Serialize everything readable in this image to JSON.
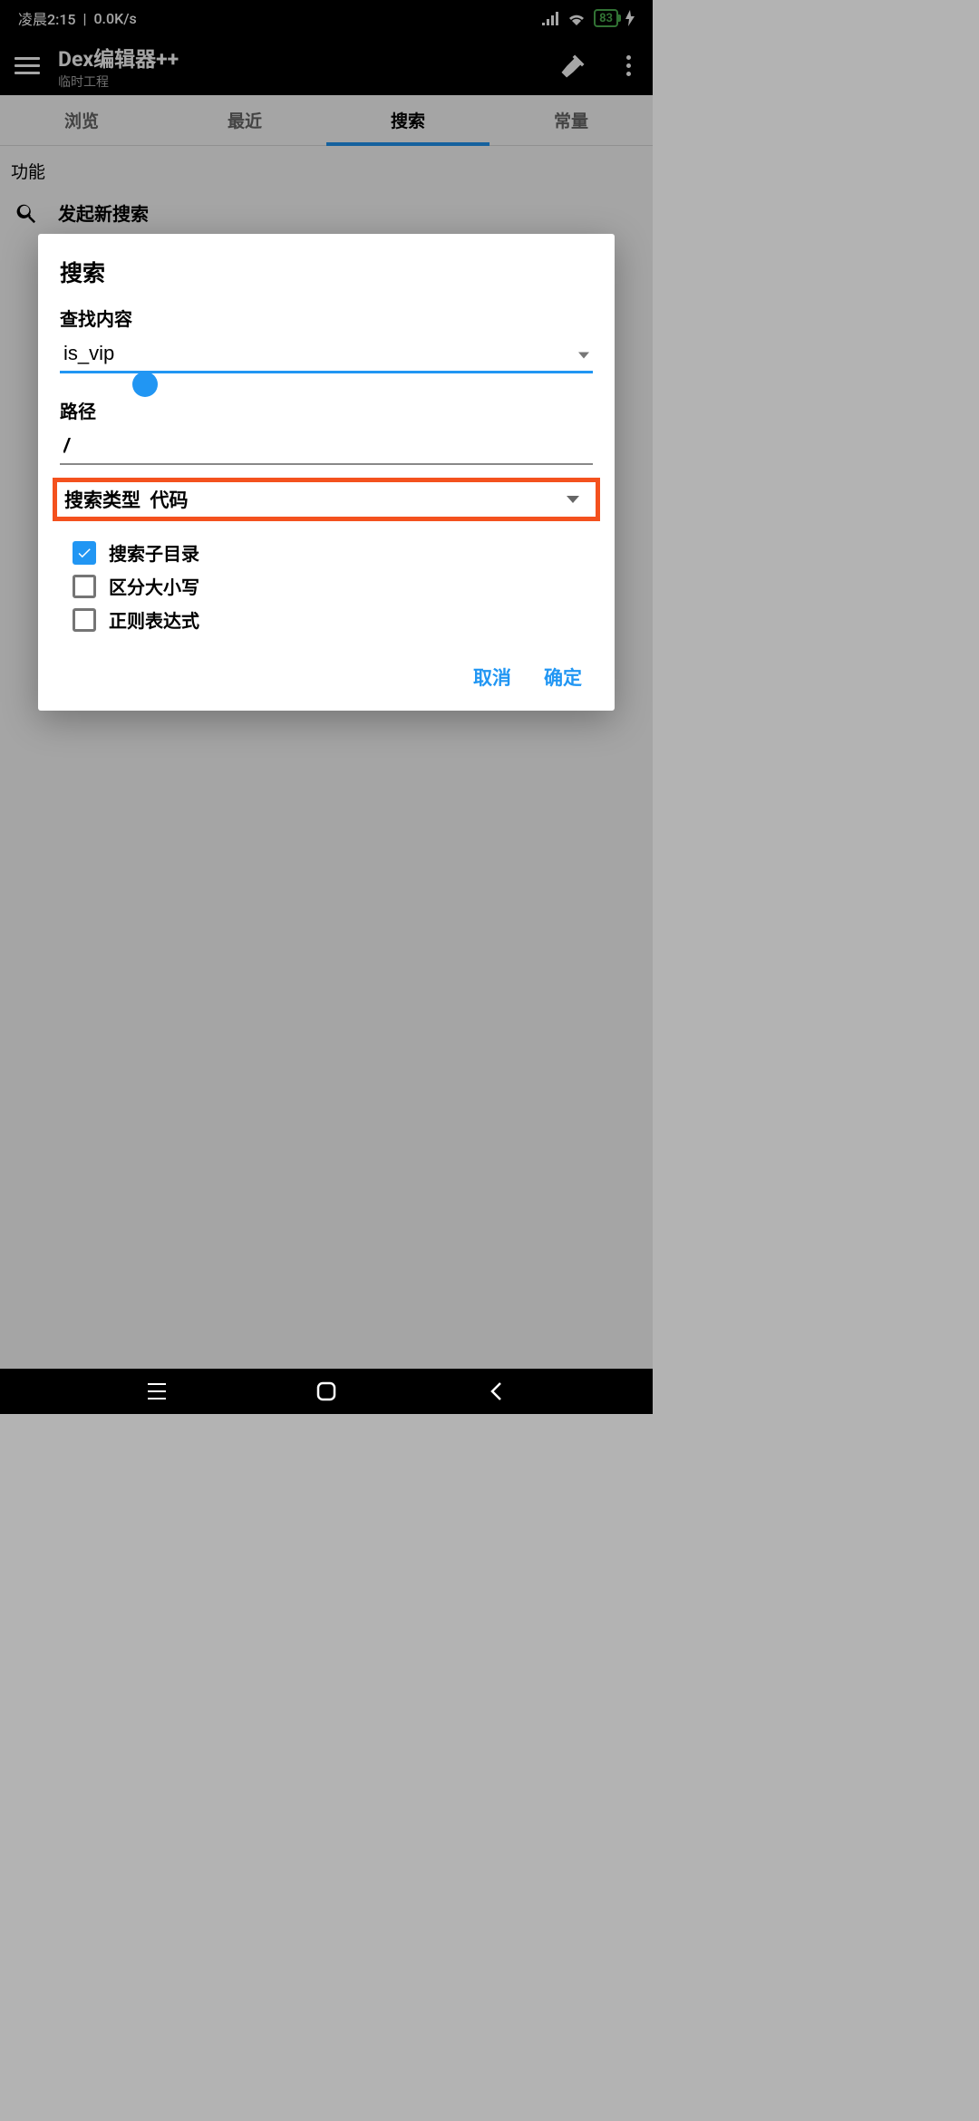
{
  "status": {
    "time_label": "凌晨2:15",
    "net_speed": "0.0K/s",
    "battery": "83"
  },
  "header": {
    "title": "Dex编辑器++",
    "subtitle": "临时工程"
  },
  "tabs": [
    "浏览",
    "最近",
    "搜索",
    "常量"
  ],
  "content": {
    "section_label": "功能",
    "new_search_label": "发起新搜索"
  },
  "dialog": {
    "title": "搜索",
    "find_label": "查找内容",
    "find_value": "is_vip",
    "path_label": "路径",
    "path_value": "/",
    "type_label": "搜索类型",
    "type_value": "代码",
    "checkboxes": [
      {
        "label": "搜索子目录",
        "checked": true
      },
      {
        "label": "区分大小写",
        "checked": false
      },
      {
        "label": "正则表达式",
        "checked": false
      }
    ],
    "cancel": "取消",
    "confirm": "确定"
  }
}
